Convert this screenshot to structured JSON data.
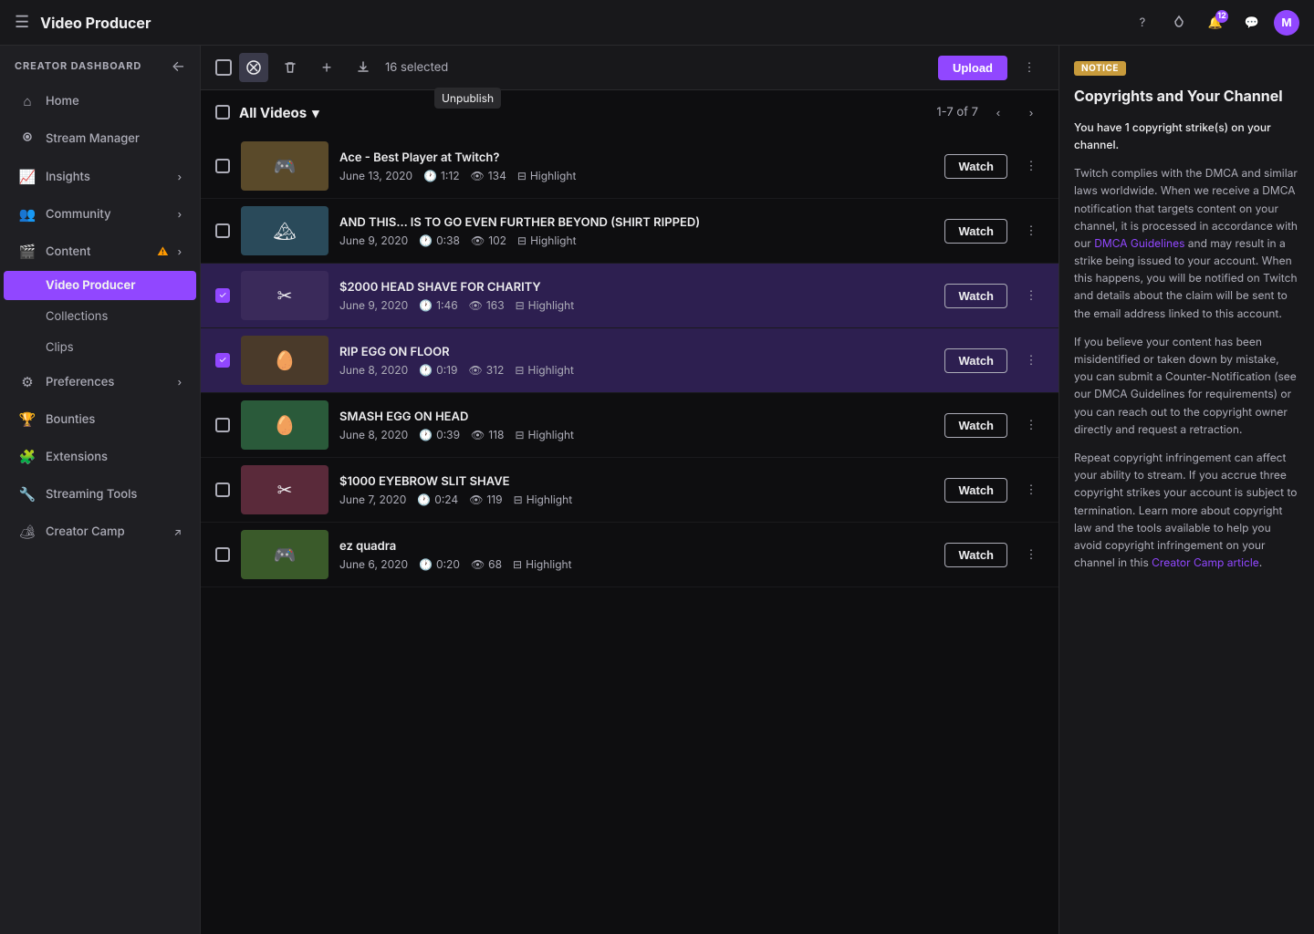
{
  "topNav": {
    "hamburgerLabel": "☰",
    "title": "Video Producer",
    "icons": {
      "help": "?",
      "drops": "◇",
      "notifications": "🔔",
      "notifBadge": "12",
      "chat": "💬",
      "avatarLetter": "M"
    }
  },
  "sidebar": {
    "creatorLabel": "CREATOR DASHBOARD",
    "backBtn": "←",
    "items": [
      {
        "id": "home",
        "icon": "⌂",
        "label": "Home",
        "hasArrow": false
      },
      {
        "id": "stream-manager",
        "icon": "◉",
        "label": "Stream Manager",
        "hasArrow": false
      },
      {
        "id": "insights",
        "icon": "📈",
        "label": "Insights",
        "hasArrow": true
      },
      {
        "id": "community",
        "icon": "👥",
        "label": "Community",
        "hasArrow": true
      },
      {
        "id": "content",
        "icon": "🎬",
        "label": "Content",
        "hasArrow": true,
        "hasWarning": true
      },
      {
        "id": "preferences",
        "icon": "⚙",
        "label": "Preferences",
        "hasArrow": true
      },
      {
        "id": "bounties",
        "icon": "🏆",
        "label": "Bounties",
        "hasArrow": false
      },
      {
        "id": "extensions",
        "icon": "🧩",
        "label": "Extensions",
        "hasArrow": false
      },
      {
        "id": "streaming-tools",
        "icon": "🔧",
        "label": "Streaming Tools",
        "hasArrow": false
      },
      {
        "id": "creator-camp",
        "icon": "🏕",
        "label": "Creator Camp",
        "hasArrow": false,
        "external": true
      }
    ],
    "subItems": [
      {
        "id": "video-producer",
        "label": "Video Producer",
        "active": true
      },
      {
        "id": "collections",
        "label": "Collections"
      },
      {
        "id": "clips",
        "label": "Clips"
      }
    ]
  },
  "toolbar": {
    "selectAllLabel": "☐",
    "unpublishIcon": "🚫",
    "deleteIcon": "🗑",
    "addIcon": "+",
    "downloadIcon": "⬇",
    "selectedCount": "16 selected",
    "uploadLabel": "Upload",
    "moreIcon": "⋮",
    "tooltipText": "Unpublish"
  },
  "videoList": {
    "headerLabel": "All Videos",
    "headerArrow": "▾",
    "pagination": {
      "info": "1-7 of 7",
      "prevBtn": "‹",
      "nextBtn": "›"
    },
    "videos": [
      {
        "id": "v1",
        "selected": false,
        "title": "Ace - Best Player at Twitch?",
        "date": "June 13, 2020",
        "duration": "1:12",
        "views": "134",
        "type": "Highlight",
        "thumbClass": "thumb-1"
      },
      {
        "id": "v2",
        "selected": false,
        "title": "AND THIS... IS TO GO EVEN FURTHER BEYOND (SHIRT RIPPED)",
        "date": "June 9, 2020",
        "duration": "0:38",
        "views": "102",
        "type": "Highlight",
        "thumbClass": "thumb-2"
      },
      {
        "id": "v3",
        "selected": true,
        "title": "$2000 HEAD SHAVE FOR CHARITY",
        "date": "June 9, 2020",
        "duration": "1:46",
        "views": "163",
        "type": "Highlight",
        "thumbClass": "thumb-3"
      },
      {
        "id": "v4",
        "selected": true,
        "title": "RIP EGG ON FLOOR",
        "date": "June 8, 2020",
        "duration": "0:19",
        "views": "312",
        "type": "Highlight",
        "thumbClass": "thumb-4"
      },
      {
        "id": "v5",
        "selected": false,
        "title": "SMASH EGG ON HEAD",
        "date": "June 8, 2020",
        "duration": "0:39",
        "views": "118",
        "type": "Highlight",
        "thumbClass": "thumb-5"
      },
      {
        "id": "v6",
        "selected": false,
        "title": "$1000 EYEBROW SLIT SHAVE",
        "date": "June 7, 2020",
        "duration": "0:24",
        "views": "119",
        "type": "Highlight",
        "thumbClass": "thumb-6"
      },
      {
        "id": "v7",
        "selected": false,
        "title": "ez quadra",
        "date": "June 6, 2020",
        "duration": "0:20",
        "views": "68",
        "type": "Highlight",
        "thumbClass": "thumb-7"
      }
    ],
    "watchLabel": "Watch"
  },
  "noticePanel": {
    "badgeLabel": "NOTICE",
    "title": "Copyrights and Your Channel",
    "paragraphs": [
      "You have 1 copyright strike(s) on your channel.",
      "Twitch complies with the DMCA and similar laws worldwide. When we receive a DMCA notification that targets content on your channel, it is processed in accordance with our DMCA Guidelines and may result in a strike being issued to your account. When this happens, you will be notified on Twitch and details about the claim will be sent to the email address linked to this account.",
      "If you believe your content has been misidentified or taken down by mistake, you can submit a Counter-Notification (see our DMCA Guidelines for requirements) or you can reach out to the copyright owner directly and request a retraction.",
      "Repeat copyright infringement can affect your ability to stream. If you accrue three copyright strikes your account is subject to termination. Learn more about copyright law and the tools available to help you avoid copyright infringement on your channel in this Creator Camp article."
    ],
    "links": {
      "dmcaGuidelines": "DMCA Guidelines",
      "creatorCamp": "Creator Camp article"
    }
  }
}
